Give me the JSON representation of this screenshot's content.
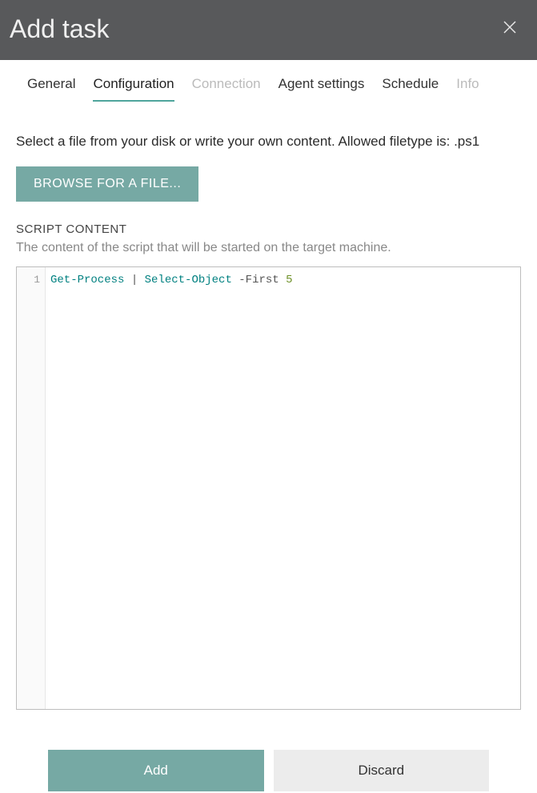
{
  "header": {
    "title": "Add task"
  },
  "tabs": [
    {
      "label": "General",
      "active": false,
      "disabled": false
    },
    {
      "label": "Configuration",
      "active": true,
      "disabled": false
    },
    {
      "label": "Connection",
      "active": false,
      "disabled": true
    },
    {
      "label": "Agent settings",
      "active": false,
      "disabled": false
    },
    {
      "label": "Schedule",
      "active": false,
      "disabled": false
    },
    {
      "label": "Info",
      "active": false,
      "disabled": true
    }
  ],
  "configuration": {
    "description": "Select a file from your disk or write your own content. Allowed filetype is: .ps1",
    "browse_label": "BROWSE FOR A FILE...",
    "script_section_label": "SCRIPT CONTENT",
    "script_section_desc": "The content of the script that will be started on the target machine.",
    "code": {
      "line_number": "1",
      "tokens": {
        "cmdlet1": "Get-Process",
        "pipe": " | ",
        "cmdlet2": "Select-Object",
        "param": " -First ",
        "number": "5"
      },
      "raw": "Get-Process | Select-Object -First 5"
    }
  },
  "footer": {
    "add_label": "Add",
    "discard_label": "Discard"
  }
}
